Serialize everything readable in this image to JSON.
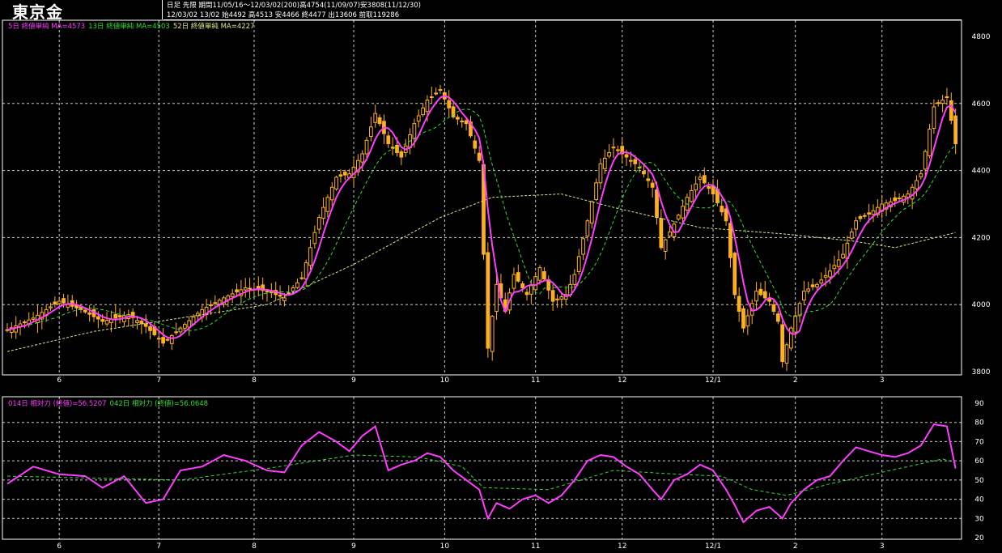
{
  "header": {
    "title": "東京金",
    "info_line1": "日足  先限  期間11/05/16〜12/03/02(200)高4754(11/09/07)安3808(11/12/30)",
    "info_line2": "12/03/02  13/02  始4492  高4513  安4466  終4477  出13606  前取119286"
  },
  "colors": {
    "background": "#000000",
    "candle": "#ffb020",
    "ma5": "#ff3cff",
    "ma13": "#33dd33",
    "ma52": "#d8e888",
    "osc14": "#ff3cff",
    "osc42": "#33dd33",
    "grid": "#ffffff",
    "text": "#ffffff"
  },
  "ma_legend": [
    {
      "text": "5日 終値単純 MA=4573",
      "color": "#ff3cff"
    },
    {
      "text": "13日 終値単純 MA=4503",
      "color": "#33dd33"
    },
    {
      "text": "52日 終値単純 MA=4227",
      "color": "#d8e888"
    }
  ],
  "osc_legend": [
    {
      "text": "014日 相対力 (終値)=56.5207",
      "color": "#ff3cff"
    },
    {
      "text": "042日 相対力 (終値)=56.0648",
      "color": "#33dd33"
    }
  ],
  "chart_data": [
    {
      "type": "candlestick",
      "title": "東京金",
      "x_tick_labels": [
        "6",
        "7",
        "8",
        "9",
        "10",
        "11",
        "12",
        "12/1",
        "2",
        "3"
      ],
      "y_tick_labels": [
        "4800",
        "4600",
        "4400",
        "4200",
        "4000",
        "3800"
      ],
      "ylim": [
        3800,
        4800
      ],
      "grid": true,
      "close_anchors": [
        [
          0,
          3925
        ],
        [
          6,
          3960
        ],
        [
          12,
          4010
        ],
        [
          17,
          3985
        ],
        [
          22,
          3950
        ],
        [
          28,
          3970
        ],
        [
          32,
          3935
        ],
        [
          36,
          3885
        ],
        [
          40,
          3930
        ],
        [
          45,
          3985
        ],
        [
          50,
          4020
        ],
        [
          55,
          4050
        ],
        [
          60,
          4040
        ],
        [
          64,
          4020
        ],
        [
          68,
          4080
        ],
        [
          72,
          4260
        ],
        [
          76,
          4380
        ],
        [
          79,
          4390
        ],
        [
          82,
          4450
        ],
        [
          85,
          4570
        ],
        [
          88,
          4480
        ],
        [
          91,
          4440
        ],
        [
          94,
          4540
        ],
        [
          97,
          4610
        ],
        [
          100,
          4640
        ],
        [
          103,
          4560
        ],
        [
          106,
          4540
        ],
        [
          109,
          4430
        ],
        [
          111,
          3870
        ],
        [
          113,
          4060
        ],
        [
          115,
          3980
        ],
        [
          117,
          4090
        ],
        [
          120,
          4030
        ],
        [
          123,
          4110
        ],
        [
          126,
          4010
        ],
        [
          129,
          4030
        ],
        [
          131,
          4090
        ],
        [
          134,
          4250
        ],
        [
          137,
          4420
        ],
        [
          140,
          4470
        ],
        [
          143,
          4440
        ],
        [
          146,
          4410
        ],
        [
          149,
          4350
        ],
        [
          151,
          4170
        ],
        [
          154,
          4240
        ],
        [
          157,
          4320
        ],
        [
          160,
          4380
        ],
        [
          163,
          4330
        ],
        [
          166,
          4250
        ],
        [
          168,
          4030
        ],
        [
          170,
          3930
        ],
        [
          173,
          4040
        ],
        [
          176,
          4010
        ],
        [
          178,
          3950
        ],
        [
          179,
          3830
        ],
        [
          181,
          3930
        ],
        [
          184,
          4040
        ],
        [
          187,
          4060
        ],
        [
          190,
          4100
        ],
        [
          193,
          4150
        ],
        [
          196,
          4250
        ],
        [
          199,
          4270
        ],
        [
          202,
          4300
        ],
        [
          205,
          4310
        ],
        [
          208,
          4330
        ],
        [
          211,
          4390
        ],
        [
          214,
          4590
        ],
        [
          217,
          4620
        ],
        [
          219,
          4480
        ]
      ],
      "sma52_anchors": [
        [
          0,
          3860
        ],
        [
          20,
          3920
        ],
        [
          40,
          3960
        ],
        [
          60,
          4000
        ],
        [
          80,
          4120
        ],
        [
          100,
          4260
        ],
        [
          112,
          4320
        ],
        [
          128,
          4330
        ],
        [
          140,
          4290
        ],
        [
          160,
          4230
        ],
        [
          180,
          4210
        ],
        [
          195,
          4190
        ],
        [
          205,
          4170
        ],
        [
          219,
          4215
        ]
      ],
      "series": [
        {
          "name": "5日 終値単純",
          "last": 4573
        },
        {
          "name": "13日 終値単純",
          "last": 4503
        },
        {
          "name": "52日 終値単純",
          "last": 4227
        }
      ]
    },
    {
      "type": "line",
      "x_tick_labels": [
        "6",
        "7",
        "8",
        "9",
        "10",
        "11",
        "12",
        "12/1",
        "2",
        "3"
      ],
      "y_tick_labels": [
        "90",
        "80",
        "70",
        "60",
        "50",
        "40",
        "30",
        "20"
      ],
      "ylim": [
        20,
        90
      ],
      "grid": true,
      "series": [
        {
          "name": "014日 相対力 (終値)",
          "last": 56.5207,
          "anchors": [
            [
              0,
              48
            ],
            [
              6,
              57
            ],
            [
              12,
              53
            ],
            [
              18,
              52
            ],
            [
              22,
              46
            ],
            [
              27,
              52
            ],
            [
              32,
              38
            ],
            [
              36,
              40
            ],
            [
              40,
              55
            ],
            [
              45,
              57
            ],
            [
              50,
              63
            ],
            [
              55,
              60
            ],
            [
              60,
              55
            ],
            [
              64,
              54
            ],
            [
              68,
              68
            ],
            [
              72,
              75
            ],
            [
              76,
              70
            ],
            [
              79,
              65
            ],
            [
              82,
              73
            ],
            [
              85,
              78
            ],
            [
              88,
              55
            ],
            [
              91,
              58
            ],
            [
              94,
              60
            ],
            [
              97,
              64
            ],
            [
              100,
              62
            ],
            [
              103,
              55
            ],
            [
              106,
              50
            ],
            [
              109,
              45
            ],
            [
              111,
              30
            ],
            [
              113,
              38
            ],
            [
              116,
              35
            ],
            [
              119,
              40
            ],
            [
              122,
              42
            ],
            [
              125,
              38
            ],
            [
              128,
              42
            ],
            [
              131,
              50
            ],
            [
              134,
              60
            ],
            [
              137,
              63
            ],
            [
              140,
              62
            ],
            [
              143,
              57
            ],
            [
              146,
              53
            ],
            [
              149,
              45
            ],
            [
              151,
              40
            ],
            [
              154,
              50
            ],
            [
              157,
              53
            ],
            [
              160,
              58
            ],
            [
              163,
              55
            ],
            [
              166,
              45
            ],
            [
              168,
              37
            ],
            [
              170,
              28
            ],
            [
              173,
              34
            ],
            [
              176,
              36
            ],
            [
              178,
              32
            ],
            [
              179,
              30
            ],
            [
              181,
              38
            ],
            [
              184,
              45
            ],
            [
              187,
              50
            ],
            [
              190,
              52
            ],
            [
              193,
              60
            ],
            [
              196,
              67
            ],
            [
              199,
              65
            ],
            [
              202,
              63
            ],
            [
              205,
              62
            ],
            [
              208,
              64
            ],
            [
              211,
              68
            ],
            [
              214,
              79
            ],
            [
              217,
              78
            ],
            [
              219,
              56
            ]
          ]
        },
        {
          "name": "042日 相対力 (終値)",
          "last": 56.0648,
          "anchors": [
            [
              0,
              52
            ],
            [
              20,
              51
            ],
            [
              40,
              50
            ],
            [
              60,
              56
            ],
            [
              80,
              63
            ],
            [
              95,
              62
            ],
            [
              105,
              57
            ],
            [
              110,
              46
            ],
            [
              125,
              45
            ],
            [
              140,
              55
            ],
            [
              155,
              53
            ],
            [
              165,
              52
            ],
            [
              172,
              45
            ],
            [
              180,
              42
            ],
            [
              190,
              48
            ],
            [
              200,
              53
            ],
            [
              210,
              58
            ],
            [
              216,
              61
            ],
            [
              219,
              59
            ]
          ]
        }
      ]
    }
  ]
}
